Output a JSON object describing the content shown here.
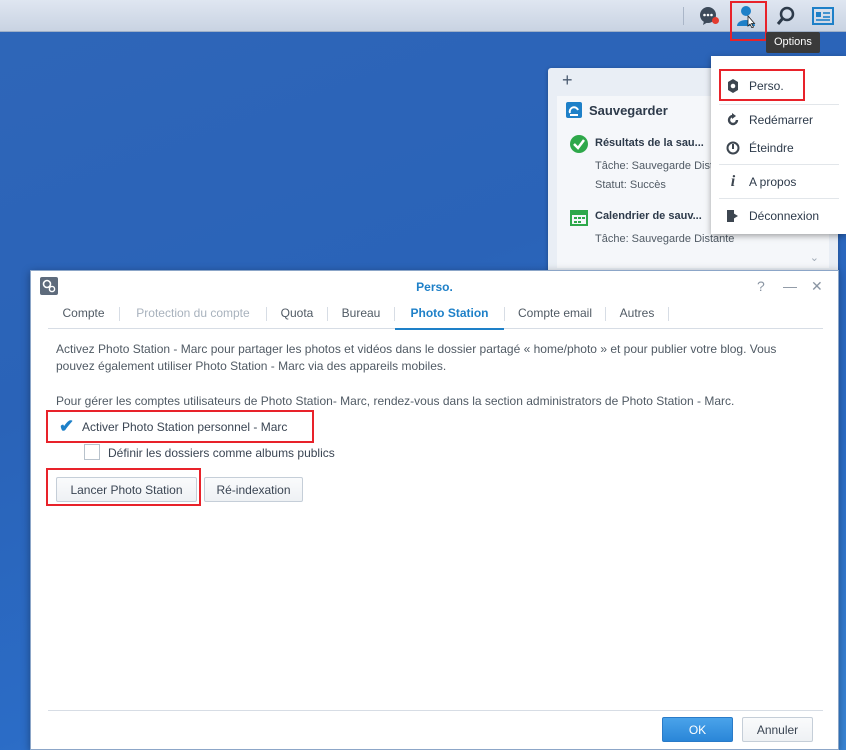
{
  "taskbar": {
    "icons": [
      "chat-icon",
      "user-icon",
      "search-icon",
      "widgets-icon"
    ],
    "tooltip": "Options"
  },
  "options_menu": {
    "items": [
      {
        "label": "Perso.",
        "icon": "gear-icon"
      },
      {
        "label": "Redémarrer",
        "icon": "restart-icon"
      },
      {
        "label": "Éteindre",
        "icon": "power-icon"
      },
      {
        "label": "A propos",
        "icon": "info-icon"
      },
      {
        "label": "Déconnexion",
        "icon": "logout-icon"
      }
    ]
  },
  "widget": {
    "add_label": "+",
    "title": "Sauvegarder",
    "result_title": "Résultats de la sau...",
    "result_task": "Tâche: Sauvegarde Dist",
    "result_status": "Statut: Succès",
    "calendar_title": "Calendrier de sauv...",
    "calendar_task": "Tâche: Sauvegarde Distante"
  },
  "dialog": {
    "title": "Perso.",
    "controls": {
      "help": "?",
      "minimize": "—",
      "close": "✕"
    },
    "tabs": [
      {
        "label": "Compte",
        "state": "normal"
      },
      {
        "label": "Protection du compte",
        "state": "disabled"
      },
      {
        "label": "Quota",
        "state": "normal"
      },
      {
        "label": "Bureau",
        "state": "normal"
      },
      {
        "label": "Photo Station",
        "state": "active"
      },
      {
        "label": "Compte email",
        "state": "normal"
      },
      {
        "label": "Autres",
        "state": "normal"
      }
    ],
    "description_line1": "Activez Photo Station - Marc pour partager les photos et vidéos dans le dossier partagé « home/photo » et pour publier votre blog. Vous",
    "description_line2": "pouvez également utiliser Photo Station - Marc via des appareils mobiles.",
    "admin_note": "Pour gérer les comptes utilisateurs de Photo Station- Marc, rendez-vous dans la section administrators de Photo Station - Marc.",
    "activate_label": "Activer Photo Station personnel - Marc",
    "activate_checked": true,
    "public_albums_label": "Définir les dossiers comme albums publics",
    "public_albums_checked": false,
    "launch_button": "Lancer Photo Station",
    "reindex_button": "Ré-indexation",
    "ok_button": "OK",
    "cancel_button": "Annuler"
  },
  "colors": {
    "accent": "#1e80c8",
    "highlight": "#e8222a",
    "success": "#2ea84a"
  }
}
